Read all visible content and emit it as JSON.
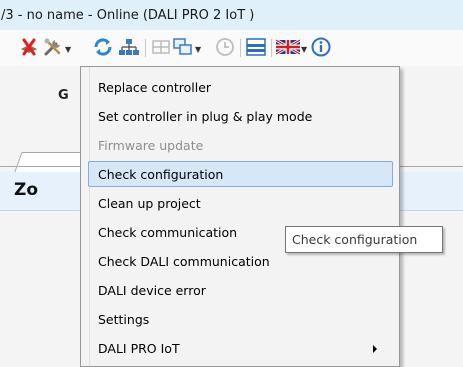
{
  "window": {
    "title": "/3 - no name - Online (DALI PRO 2 IoT )"
  },
  "toolbar": {
    "icons": [
      "disconnect-icon",
      "tools-icon",
      "refresh-icon",
      "network-icon",
      "grid-icon",
      "copy-icon",
      "clock-icon",
      "list-icon",
      "uk-flag-icon",
      "info-icon"
    ]
  },
  "tab": {
    "label": "G"
  },
  "zone": {
    "header": "Zo"
  },
  "menu": {
    "items": [
      {
        "label": "Replace controller",
        "state": "enabled"
      },
      {
        "label": "Set controller in plug & play mode",
        "state": "enabled"
      },
      {
        "label": "Firmware update",
        "state": "disabled"
      },
      {
        "label": "Check configuration",
        "state": "highlighted"
      },
      {
        "label": "Clean up project",
        "state": "enabled"
      },
      {
        "label": "Check communication",
        "state": "enabled"
      },
      {
        "label": "Check DALI communication",
        "state": "enabled"
      },
      {
        "label": "DALI device error",
        "state": "enabled"
      },
      {
        "label": "Settings",
        "state": "enabled"
      },
      {
        "label": "DALI PRO IoT",
        "state": "enabled",
        "has_submenu": true
      }
    ]
  },
  "tooltip": {
    "text": "Check configuration"
  },
  "colors": {
    "highlight": "#d6e8f7",
    "highlight_border": "#84acdd",
    "titlebar": "#dff0fb"
  }
}
